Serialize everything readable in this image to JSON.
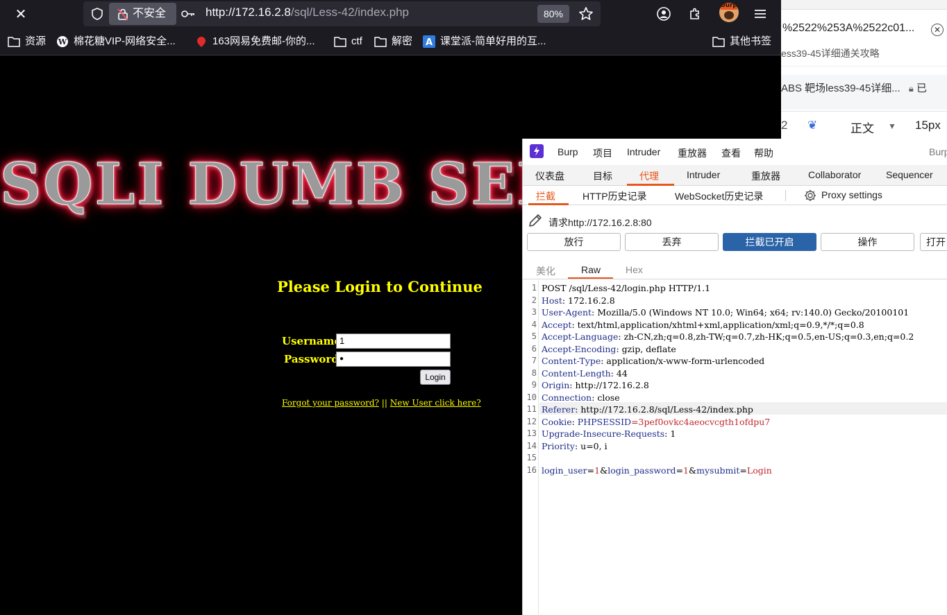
{
  "firefox": {
    "insecure_label": "不安全",
    "url_host": "http://172.16.2.8",
    "url_path": "/sql/Less-42/index.php",
    "zoom": "80%",
    "burp_ext_label": "burp"
  },
  "bookmarks": [
    {
      "label": "资源",
      "icon": "folder-icon"
    },
    {
      "label": "棉花糖VIP-网络安全...",
      "icon": "wordpress-icon"
    },
    {
      "label": "163网易免费邮-你的...",
      "icon": "mail163-icon"
    },
    {
      "label": "ctf",
      "icon": "folder-icon"
    },
    {
      "label": "解密",
      "icon": "folder-icon"
    },
    {
      "label": "课堂派-简单好用的互...",
      "icon": "ketangpai-icon"
    },
    {
      "label": "其他书签",
      "icon": "folder-icon"
    }
  ],
  "background_window": {
    "url_fragment": "%2522%253A%2522c01...",
    "breadcrumb": "ess39-45详细通关攻略",
    "title": "ABS 靶场less39-45详细...",
    "title_suffix": "已",
    "toolbar_style": "正文",
    "toolbar_size": "15px"
  },
  "page": {
    "banner": "SQLI DUMB SERIES",
    "login_title": "Please Login to Continue",
    "username_label": "Username:",
    "password_label": "Password:",
    "username_value": "1",
    "password_value": "●",
    "login_button": "Login",
    "forgot_link": "Forgot your password?",
    "separator": "||",
    "new_user_link": "New User click here?"
  },
  "burp": {
    "menu": [
      "Burp",
      "项目",
      "Intruder",
      "重放器",
      "查看",
      "帮助"
    ],
    "menu_right": "Burp",
    "main_tabs": [
      "仪表盘",
      "目标",
      "代理",
      "Intruder",
      "重放器",
      "Collaborator",
      "Sequencer"
    ],
    "active_main_tab": "代理",
    "sub_tabs": [
      "拦截",
      "HTTP历史记录",
      "WebSocket历史记录"
    ],
    "proxy_settings": "Proxy settings",
    "request_to": "请求http://172.16.2.8:80",
    "buttons": {
      "forward": "放行",
      "drop": "丢弃",
      "intercept": "拦截已开启",
      "action": "操作",
      "open": "打开"
    },
    "editor_tabs": [
      "美化",
      "Raw",
      "Hex"
    ],
    "request_lines": [
      {
        "n": "1",
        "key": "",
        "val": "POST /sql/Less-42/login.php HTTP/1.1"
      },
      {
        "n": "2",
        "key": "Host",
        "val": ": 172.16.2.8"
      },
      {
        "n": "3",
        "key": "User-Agent",
        "val": ": Mozilla/5.0 (Windows NT 10.0; Win64; x64; rv:140.0) Gecko/20100101"
      },
      {
        "n": "4",
        "key": "Accept",
        "val": ": text/html,application/xhtml+xml,application/xml;q=0.9,*/*;q=0.8"
      },
      {
        "n": "5",
        "key": "Accept-Language",
        "val": ": zh-CN,zh;q=0.8,zh-TW;q=0.7,zh-HK;q=0.5,en-US;q=0.3,en;q=0.2"
      },
      {
        "n": "6",
        "key": "Accept-Encoding",
        "val": ": gzip, deflate"
      },
      {
        "n": "7",
        "key": "Content-Type",
        "val": ": application/x-www-form-urlencoded"
      },
      {
        "n": "8",
        "key": "Content-Length",
        "val": ": 44"
      },
      {
        "n": "9",
        "key": "Origin",
        "val": ": http://172.16.2.8"
      },
      {
        "n": "10",
        "key": "Connection",
        "val": ": close"
      },
      {
        "n": "11",
        "key": "Referer",
        "val": ": http://172.16.2.8/sql/Less-42/index.php"
      },
      {
        "n": "12",
        "key": "Cookie",
        "val": ": "
      },
      {
        "n": "13",
        "key": "Upgrade-Insecure-Requests",
        "val": ": 1"
      },
      {
        "n": "14",
        "key": "Priority",
        "val": ": u=0, i"
      },
      {
        "n": "15",
        "key": "",
        "val": ""
      },
      {
        "n": "16",
        "key": "",
        "val": ""
      }
    ],
    "cookie": {
      "name": "PHPSESSID",
      "eq": "=",
      "value": "3pef0ovkc4aeocvcgth1ofdpu7"
    },
    "body": {
      "p1": "login_user",
      "v1": "1",
      "p2": "login_password",
      "v2": "1",
      "p3": "mysubmit",
      "v3": "Login"
    }
  }
}
